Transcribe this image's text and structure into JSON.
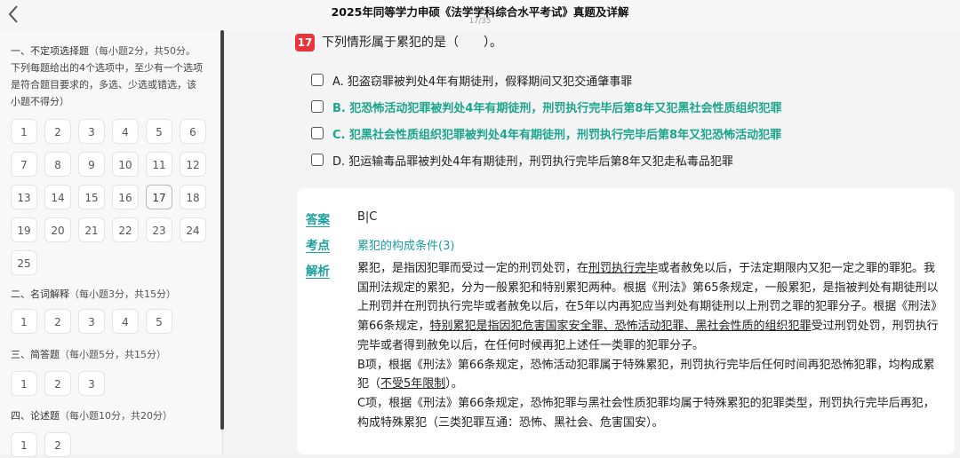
{
  "header": {
    "title": "2025年同等学力申硕《法学学科综合水平考试》真题及详解",
    "progress": "17/35"
  },
  "sidebar": {
    "sections": [
      {
        "title": "一、不定项选择题",
        "info": "（每小题2分，共50分。",
        "desc": [
          "下列每题给出的4个选项中，至少有一个选项",
          "是符合题目要求的，多选、少选或错选，该",
          "小题不得分）"
        ],
        "items": [
          "1",
          "2",
          "3",
          "4",
          "5",
          "6",
          "7",
          "8",
          "9",
          "10",
          "11",
          "12",
          "13",
          "14",
          "15",
          "16",
          "17",
          "18",
          "19",
          "20",
          "21",
          "22",
          "23",
          "24",
          "25"
        ]
      },
      {
        "title": "二、名词解释",
        "info": "（每小题3分，共15分）",
        "items": [
          "1",
          "2",
          "3",
          "4",
          "5"
        ]
      },
      {
        "title": "三、简答题",
        "info": "（每小题5分，共15分）",
        "items": [
          "1",
          "2",
          "3"
        ]
      },
      {
        "title": "四、论述题",
        "info": "（每小题10分，共20分）",
        "items": [
          "1",
          "2"
        ]
      }
    ],
    "active_item": "17"
  },
  "question": {
    "number": "17",
    "text": "下列情形属于累犯的是（　　）。",
    "options": [
      {
        "text": "A.  犯盗窃罪被判处4年有期徒刑，假释期间又犯交通肇事罪",
        "correct": false
      },
      {
        "text": "B.  犯恐怖活动犯罪被判处4年有期徒刑，刑罚执行完毕后第8年又犯黑社会性质组织犯罪",
        "correct": true
      },
      {
        "text": "C.  犯黑社会性质组织犯罪被判处4年有期徒刑，刑罚执行完毕后第8年又犯恐怖活动犯罪",
        "correct": true
      },
      {
        "text": "D.  犯运输毒品罪被判处4年有期徒刑，刑罚执行完毕后第8年又犯走私毒品犯罪",
        "correct": false
      }
    ]
  },
  "answer": {
    "answer_label": "答案",
    "answer_value": "B|C",
    "point_label": "考点",
    "point_value": "累犯的构成条件(3)",
    "analysis_label": "解析",
    "analysis": {
      "p1_a": "累犯，是指因犯罪而受过一定的刑罚处罚，在",
      "p1_u1": "刑罚执行完毕",
      "p1_b": "或者赦免以后，于法定期限内又犯一定之罪的罪犯。我国刑法规定的累犯，分为一般累犯和特别累犯两种。根据《刑法》第65条规定，一般累犯，是指被判处有期徒刑以上刑罚并在刑罚执行完毕或者赦免以后，在5年以内再犯应当判处有期徒刑以上刑罚之罪的犯罪分子。根据《刑法》第66条规定，",
      "p1_u2": "特别累犯是指因犯危害国家安全罪、恐怖活动犯罪、黑社会性质的组织犯罪",
      "p1_c": "受过刑罚处罚，刑罚执行完毕或者得到赦免以后，在任何时候再犯上述任一类罪的犯罪分子。",
      "p2_a": "B项，根据《刑法》第66条规定，恐怖活动犯罪属于特殊累犯，刑罚执行完毕后任何时间再犯恐怖犯罪，均构成累犯（",
      "p2_u": "不受5年限制",
      "p2_b": "）。",
      "p3": "C项，根据《刑法》第66条规定，恐怖犯罪与黑社会性质犯罪均属于特殊累犯的犯罪类型，刑罚执行完毕后再犯，构成特殊累犯（三类犯罪互通：恐怖、黑社会、危害国安）。"
    }
  }
}
